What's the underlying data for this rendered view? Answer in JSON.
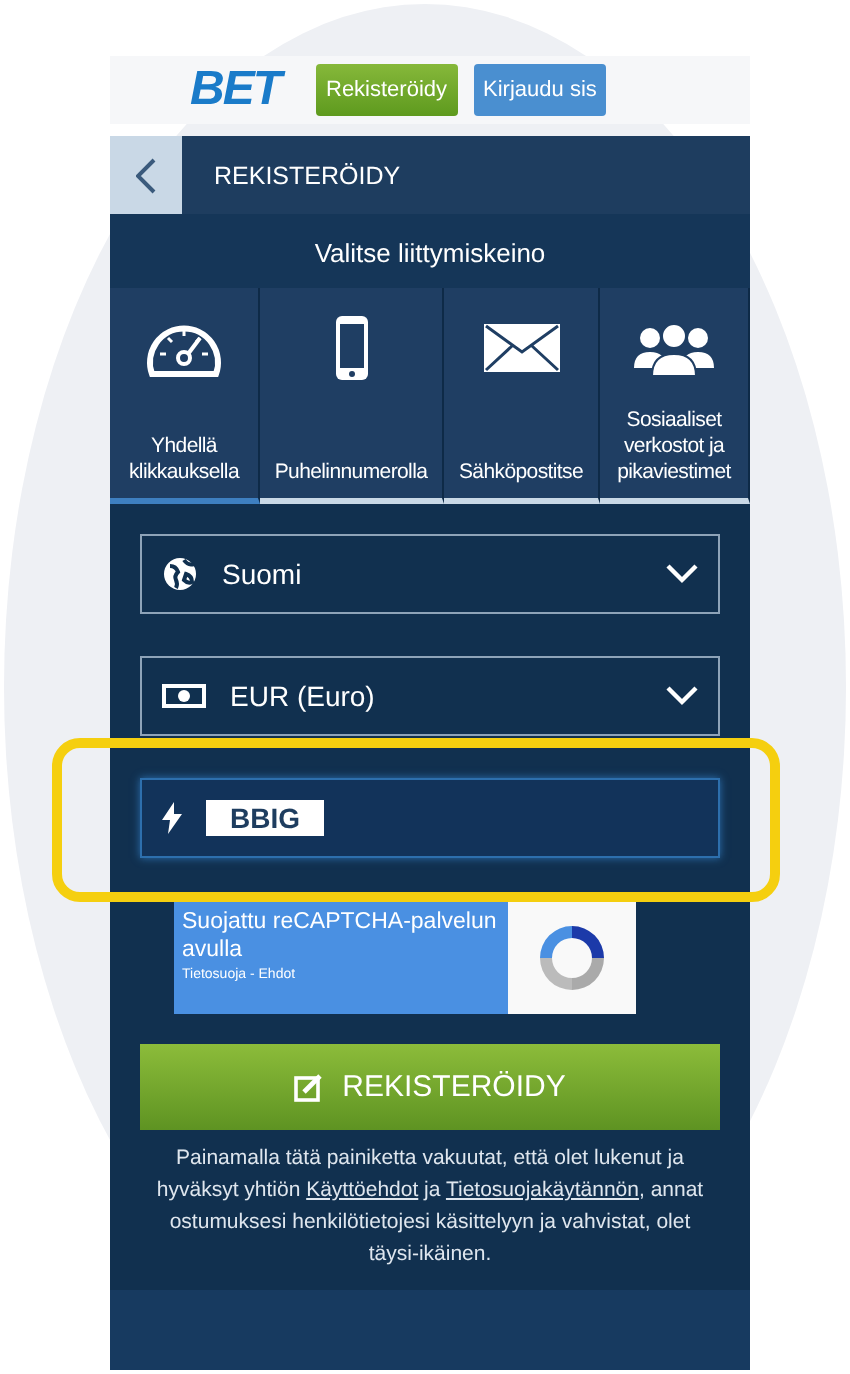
{
  "header": {
    "logo": "BET",
    "buttons": [
      {
        "label": "Rekisteröidy",
        "kind": "register"
      },
      {
        "label": "Kirjaudu sis",
        "kind": "login"
      }
    ]
  },
  "title_bar": {
    "title": "REKISTERÖIDY"
  },
  "method_heading": "Valitse liittymiskeino",
  "tabs": [
    {
      "label": "Yhdellä klikkauksella",
      "kind": "speedometer",
      "selected": true
    },
    {
      "label": "Puhelinnumerolla",
      "kind": "phone",
      "selected": false
    },
    {
      "label": "Sähköpostitse",
      "kind": "email",
      "selected": false
    },
    {
      "label": "Sosiaaliset verkostot ja pikaviestimet",
      "kind": "social",
      "selected": false
    }
  ],
  "fields": [
    {
      "kind": "country",
      "value": "Suomi",
      "highlighted": false
    },
    {
      "kind": "currency",
      "value": "EUR (Euro)",
      "highlighted": false
    },
    {
      "kind": "promo",
      "value": "BBIG",
      "highlighted": true
    }
  ],
  "recaptcha": {
    "text": "Suojattu reCAPTCHA-palvelun avulla",
    "links": "Tietosuoja - Ehdot"
  },
  "submit": {
    "label": "REKISTERÖIDY"
  },
  "disclaimer": [
    {
      "kind": "text",
      "text": "Painamalla tätä painiketta vakuutat, että olet lukenut ja hyväksyt yhtiön "
    },
    {
      "kind": "link",
      "text": "Käyttöehdot"
    },
    {
      "kind": "text",
      "text": " ja "
    },
    {
      "kind": "link",
      "text": "Tietosuojakäytännön"
    },
    {
      "kind": "text",
      "text": ", annat ostumuksesi henkilötietojesi käsittelyyn ja vahvistat, olet täysi-ikäinen."
    }
  ]
}
